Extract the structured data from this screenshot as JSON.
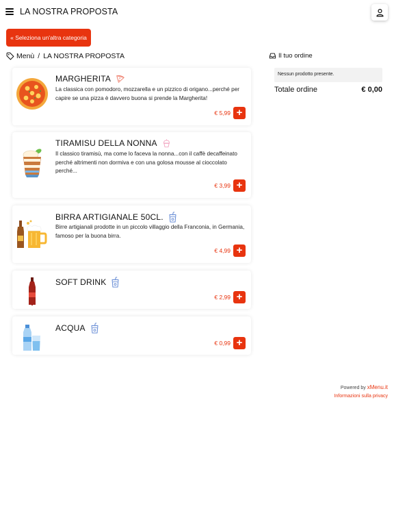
{
  "header": {
    "title": "LA NOSTRA PROPOSTA"
  },
  "category_button": {
    "label": "« Seleziona un'altra categoria"
  },
  "breadcrumb": {
    "root": "Menù",
    "separator": "/",
    "current": "LA NOSTRA PROPOSTA"
  },
  "order": {
    "title": "Il tuo ordine",
    "empty_message": "Nessun prodotto presente.",
    "total_label": "Totale ordine",
    "total_value": "€ 0,00"
  },
  "products": [
    {
      "name": "MARGHERITA",
      "icon": "pizza-slice-icon",
      "description": "La classica con pomodoro, mozzarella e un pizzico di origano...perché per capire se una pizza è davvero buona si prende la Margherita!",
      "price": "€ 5,99"
    },
    {
      "name": "TIRAMISU DELLA NONNA",
      "icon": "cupcake-icon",
      "description": "Il classico tiramisù, ma come lo faceva la nonna...con il caffè decaffeinato perché altrimenti non dormiva e con una golosa mousse al cioccolato perché...",
      "price": "€ 3,99"
    },
    {
      "name": "BIRRA ARTIGIANALE 50CL.",
      "icon": "drink-cup-icon",
      "description": "Birre artigianali prodotte in un piccolo villaggio della Franconia, in Germania, famoso per la buona birra.",
      "price": "€ 4,99"
    },
    {
      "name": "SOFT DRINK",
      "icon": "drink-cup-icon",
      "description": "",
      "price": "€ 2,99"
    },
    {
      "name": "ACQUA",
      "icon": "drink-cup-icon",
      "description": "",
      "price": "€ 0,99"
    }
  ],
  "footer": {
    "powered_by": "Powered by",
    "brand": "xMenu.it",
    "privacy": "Informazioni sulla privacy"
  },
  "colors": {
    "accent": "#e8340f"
  }
}
